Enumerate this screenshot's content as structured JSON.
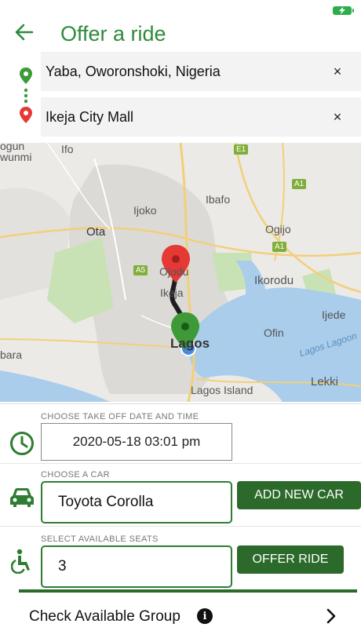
{
  "header": {
    "title": "Offer a ride",
    "back_icon": "arrow-left-icon"
  },
  "route": {
    "from": "Yaba, Oworonshoki, Nigeria",
    "to": "Ikeja City Mall",
    "clear_symbol": "×"
  },
  "map": {
    "labels": {
      "ogun": "ogun",
      "wunmi": "wunmi",
      "ifo": "Ifo",
      "ijoko": "Ijoko",
      "ibafo": "Ibafo",
      "ota": "Ota",
      "ogijo": "Ogijo",
      "ojodu": "Ojodu",
      "ikeja": "Ikeja",
      "ikorodu": "Ikorodu",
      "ijede": "Ijede",
      "ofin": "Ofin",
      "lagos": "Lagos",
      "lagos_lagoon": "Lagos Lagoon",
      "bara": "bara",
      "lekki": "Lekki",
      "lagos_island": "Lagos Island"
    },
    "badges": {
      "e1": "E1",
      "a1_top": "A1",
      "a1_mid": "A1",
      "a5": "A5"
    },
    "colors": {
      "origin_pin": "#3d9a37",
      "destination_pin": "#e53935",
      "route": "#222222",
      "water": "#a9cdea",
      "park": "#c8e2b6"
    }
  },
  "form": {
    "datetime": {
      "label": "CHOOSE TAKE OFF DATE AND TIME",
      "value": "2020-05-18 03:01 pm"
    },
    "car": {
      "label": "CHOOSE A CAR",
      "value": "Toyota  Corolla",
      "add_button": "ADD NEW CAR"
    },
    "seats": {
      "label": "SELECT AVAILABLE SEATS",
      "value": "3",
      "offer_button": "OFFER RIDE"
    },
    "group": {
      "label": "Check Available Group",
      "info_symbol": "i"
    }
  },
  "theme": {
    "accent": "#2e8b3a",
    "button": "#2b6a2b"
  }
}
